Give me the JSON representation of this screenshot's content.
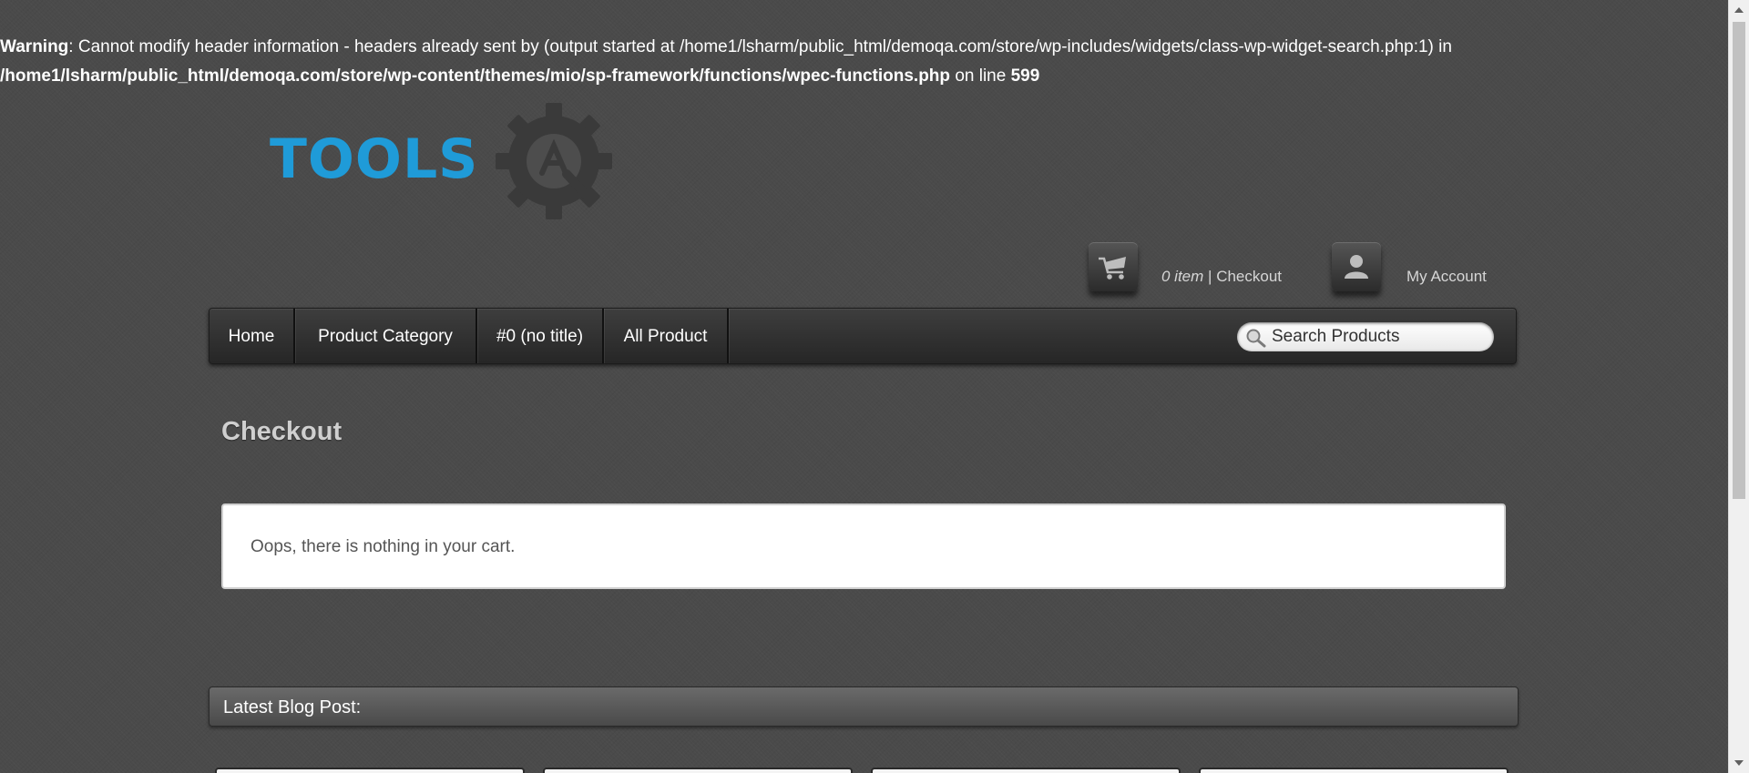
{
  "warning": {
    "label": "Warning",
    "message": ": Cannot modify header information - headers already sent by (output started at /home1/lsharm/public_html/demoqa.com/store/wp-includes/widgets/class-wp-widget-search.php:1) in",
    "file": "/home1/lsharm/public_html/demoqa.com/store/wp-content/themes/mio/sp-framework/functions/wpec-functions.php",
    "line_prefix": "on line",
    "line_number": "599"
  },
  "logo": {
    "text": "TOOLS",
    "badge_letter": "A",
    "text_color": "#1f9bd8",
    "gear_color": "#3a3a3a"
  },
  "header_links": {
    "cart_icon": "cart-icon",
    "cart_count": "0 item",
    "separator": "|",
    "checkout_label": "Checkout",
    "account_icon": "user-icon",
    "account_label": "My Account"
  },
  "nav": {
    "items": [
      {
        "label": "Home"
      },
      {
        "label": "Product Category"
      },
      {
        "label": "#0 (no title)"
      },
      {
        "label": "All Product"
      }
    ],
    "search": {
      "placeholder": "Search Products",
      "value": "",
      "icon": "search-icon"
    }
  },
  "main": {
    "title": "Checkout",
    "cart_message": "Oops, there is nothing in your cart."
  },
  "blog": {
    "heading": "Latest Blog Post:"
  },
  "colors": {
    "background": "#4a4a4a",
    "nav_bar": "#2e2e2e",
    "title_text": "#cfcfcf",
    "accent": "#1f9bd8"
  }
}
